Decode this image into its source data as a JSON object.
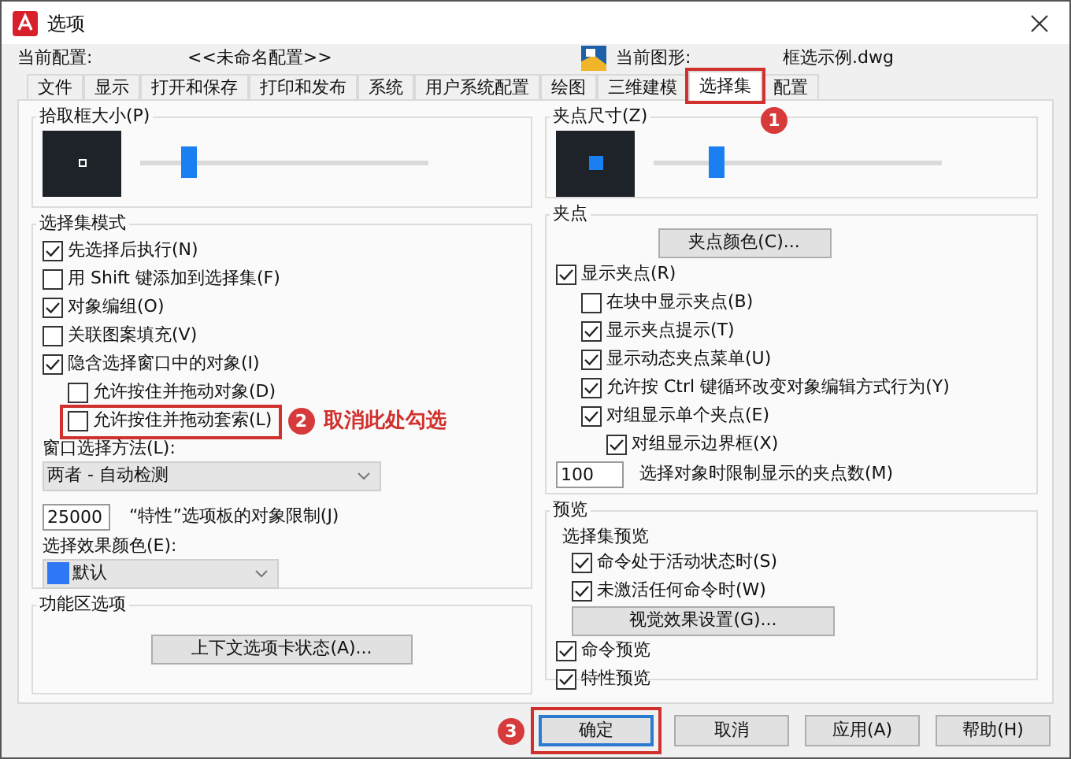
{
  "window": {
    "title": "选项"
  },
  "profile": {
    "label": "当前配置:",
    "value": "<<未命名配置>>"
  },
  "drawing": {
    "label": "当前图形:",
    "value": "框选示例.dwg"
  },
  "tabs": [
    {
      "label": "文件",
      "selected": false,
      "outlined": false
    },
    {
      "label": "显示",
      "selected": false,
      "outlined": false
    },
    {
      "label": "打开和保存",
      "selected": false,
      "outlined": false
    },
    {
      "label": "打印和发布",
      "selected": false,
      "outlined": false
    },
    {
      "label": "系统",
      "selected": false,
      "outlined": false
    },
    {
      "label": "用户系统配置",
      "selected": false,
      "outlined": false
    },
    {
      "label": "绘图",
      "selected": false,
      "outlined": false
    },
    {
      "label": "三维建模",
      "selected": false,
      "outlined": false
    },
    {
      "label": "选择集",
      "selected": true,
      "outlined": true,
      "badge": "1"
    },
    {
      "label": "配置",
      "selected": false,
      "outlined": false
    }
  ],
  "pickbox": {
    "title": "拾取框大小(P)",
    "level": 0.17
  },
  "selection_modes": {
    "title": "选择集模式",
    "options": [
      {
        "label": "先选择后执行(N)",
        "checked": true,
        "outlined": false
      },
      {
        "label": "用 Shift 键添加到选择集(F)",
        "checked": false,
        "outlined": false
      },
      {
        "label": "对象编组(O)",
        "checked": true,
        "outlined": false
      },
      {
        "label": "关联图案填充(V)",
        "checked": false,
        "outlined": false
      },
      {
        "label": "隐含选择窗口中的对象(I)",
        "checked": true,
        "outlined": false,
        "children": [
          {
            "label": "允许按住并拖动对象(D)",
            "checked": false,
            "outlined": false
          },
          {
            "label": "允许按住并拖动套索(L)",
            "checked": false,
            "outlined": true,
            "badge": "2",
            "note": "取消此处勾选"
          }
        ]
      }
    ],
    "window_method": {
      "label": "窗口选择方法(L):",
      "value": "两者 - 自动检测"
    },
    "object_limit": {
      "value": "25000",
      "label": "“特性”选项板的对象限制(J)"
    },
    "effect_color": {
      "label": "选择效果颜色(E):",
      "value": "默认"
    }
  },
  "ribbon": {
    "title": "功能区选项",
    "button": "上下文选项卡状态(A)..."
  },
  "grip_size": {
    "title": "夹点尺寸(Z)",
    "level": 0.22
  },
  "grips": {
    "title": "夹点",
    "button": "夹点颜色(C)...",
    "options": [
      {
        "label": "显示夹点(R)",
        "checked": true,
        "children": [
          {
            "label": "在块中显示夹点(B)",
            "checked": false
          },
          {
            "label": "显示夹点提示(T)",
            "checked": true
          },
          {
            "label": "显示动态夹点菜单(U)",
            "checked": true
          },
          {
            "label": "允许按 Ctrl 键循环改变对象编辑方式行为(Y)",
            "checked": true
          },
          {
            "label": "对组显示单个夹点(E)",
            "checked": true,
            "children": [
              {
                "label": "对组显示边界框(X)",
                "checked": true
              }
            ]
          }
        ]
      }
    ],
    "limit": {
      "value": "100",
      "label": "选择对象时限制显示的夹点数(M)"
    }
  },
  "preview": {
    "title": "预览",
    "subtitle": "选择集预览",
    "options": [
      {
        "label": "命令处于活动状态时(S)",
        "checked": true
      },
      {
        "label": "未激活任何命令时(W)",
        "checked": true
      }
    ],
    "button": "视觉效果设置(G)...",
    "options2": [
      {
        "label": "命令预览",
        "checked": true
      },
      {
        "label": "特性预览",
        "checked": true
      }
    ]
  },
  "buttons": [
    {
      "label": "确定",
      "default": true,
      "outlined": true,
      "badge": "3"
    },
    {
      "label": "取消",
      "default": false,
      "outlined": false
    },
    {
      "label": "应用(A)",
      "default": false,
      "outlined": false
    },
    {
      "label": "帮助(H)",
      "default": false,
      "outlined": false
    }
  ]
}
